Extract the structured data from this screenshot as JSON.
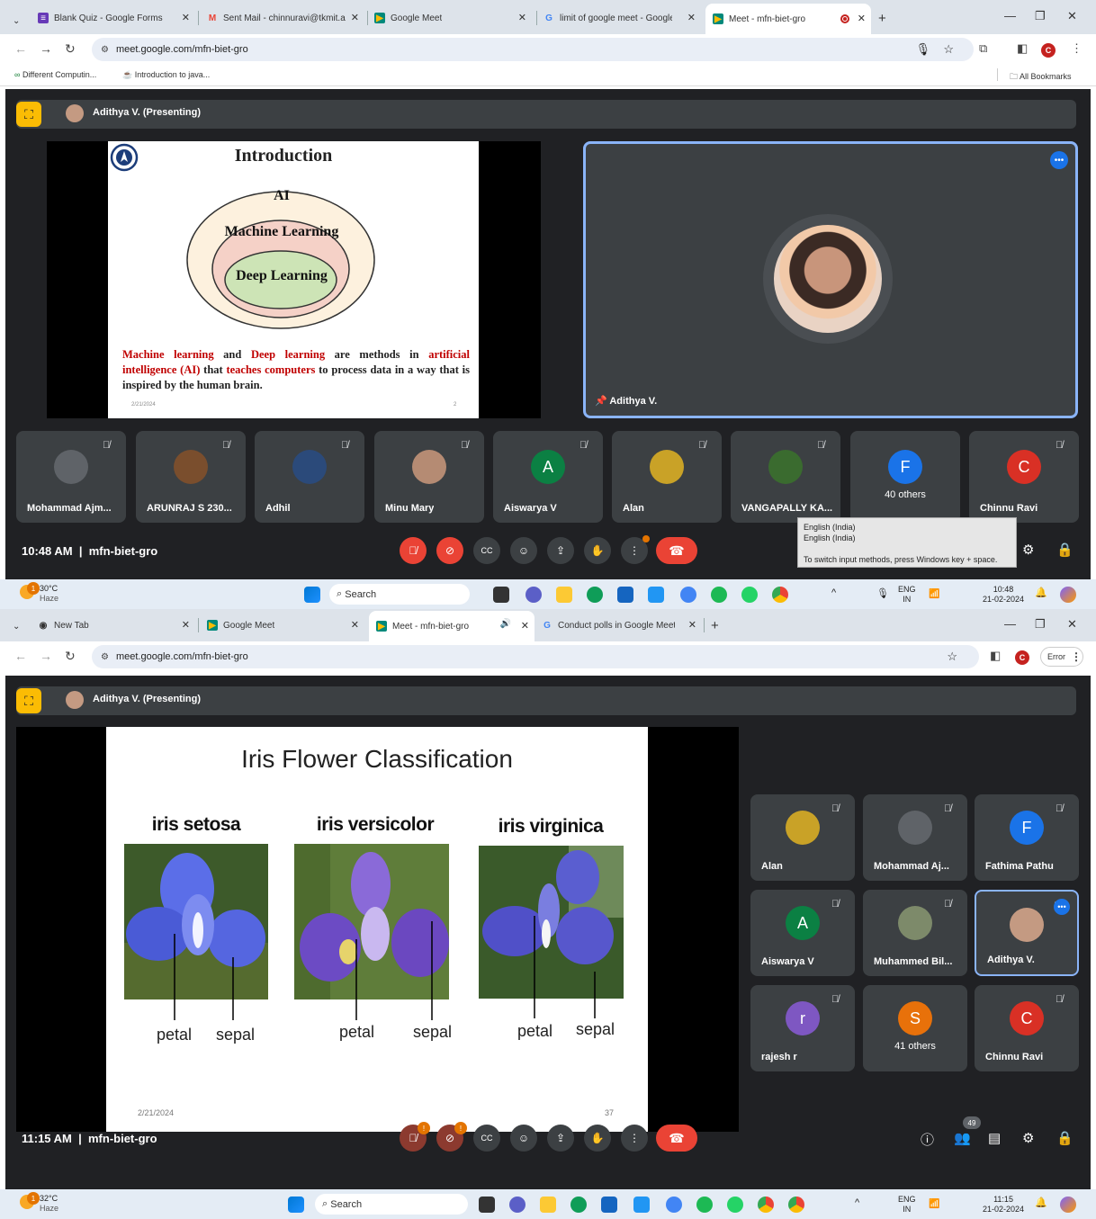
{
  "screen1": {
    "tabs": [
      {
        "label": "Blank Quiz - Google Forms",
        "icon": "forms-icon"
      },
      {
        "label": "Sent Mail - chinnuravi@tkmit.a",
        "icon": "gmail-icon"
      },
      {
        "label": "Google Meet",
        "icon": "meet-icon"
      },
      {
        "label": "limit of google meet - Google S",
        "icon": "google-icon"
      },
      {
        "label": "Meet - mfn-biet-gro",
        "icon": "meet-icon"
      }
    ],
    "url": "meet.google.com/mfn-biet-gro",
    "bookmarks": [
      "Different Computin...",
      "Introduction to java..."
    ],
    "all_bookmarks": "All Bookmarks",
    "presenter_label": "Adithya V. (Presenting)",
    "slide": {
      "title": "Introduction",
      "ring_outer": "AI",
      "ring_middle": "Machine Learning",
      "ring_inner": "Deep Learning",
      "text_parts": [
        "Machine learning",
        " and ",
        "Deep learning",
        " are methods in ",
        "artificial intelligence (AI)",
        " that ",
        "teaches computers",
        " to process data in a way that is inspired by the human brain."
      ],
      "date": "2/21/2024",
      "page": "2"
    },
    "spotlight_name": "Adithya V.",
    "participants": [
      {
        "name": "Mohammad Ajm...",
        "initial": "",
        "color": "#5f6368"
      },
      {
        "name": "ARUNRAJ S 230...",
        "initial": "",
        "color": "#7a4e2d"
      },
      {
        "name": "Adhil",
        "initial": "",
        "color": "#2b4a7a"
      },
      {
        "name": "Minu Mary",
        "initial": "",
        "color": "#b58b73"
      },
      {
        "name": "Aiswarya V",
        "initial": "A",
        "color": "#0b8043"
      },
      {
        "name": "Alan",
        "initial": "",
        "color": "#c9a227"
      },
      {
        "name": "VANGAPALLY KA...",
        "initial": "",
        "color": "#3a6b2f"
      },
      {
        "name": "Chinnu Ravi",
        "initial": "C",
        "color": "#d93025"
      }
    ],
    "others": {
      "label": "40 others",
      "initial": "F"
    },
    "time": "10:48 AM",
    "meeting_code": "mfn-biet-gro",
    "ime_tooltip": {
      "line1": "English (India)",
      "line2": "English (India)",
      "line3": "To switch input methods, press Windows key + space."
    },
    "taskbar": {
      "temp": "30°C",
      "weather": "Haze",
      "search": "Search",
      "lang1": "ENG",
      "lang2": "IN",
      "clock_time": "10:48",
      "clock_date": "21-02-2024",
      "badge": "1"
    }
  },
  "screen2": {
    "tabs": [
      {
        "label": "New Tab",
        "icon": "chrome-icon"
      },
      {
        "label": "Google Meet",
        "icon": "meet-icon"
      },
      {
        "label": "Meet - mfn-biet-gro",
        "icon": "meet-icon"
      },
      {
        "label": "Conduct polls in Google Meet",
        "icon": "google-icon"
      }
    ],
    "url": "meet.google.com/mfn-biet-gro",
    "error_label": "Error",
    "presenter_label": "Adithya V. (Presenting)",
    "slide": {
      "title": "Iris Flower Classification",
      "flowers": [
        {
          "name": "iris setosa",
          "label1": "petal",
          "label2": "sepal"
        },
        {
          "name": "iris versicolor",
          "label1": "petal",
          "label2": "sepal"
        },
        {
          "name": "iris virginica",
          "label1": "petal",
          "label2": "sepal"
        }
      ],
      "date": "2/21/2024",
      "page": "37"
    },
    "participants": [
      {
        "name": "Alan",
        "initial": "",
        "color": "#c9a227"
      },
      {
        "name": "Mohammad Aj...",
        "initial": "",
        "color": "#5f6368"
      },
      {
        "name": "Fathima Pathu",
        "initial": "F",
        "color": "#1a73e8"
      },
      {
        "name": "Aiswarya V",
        "initial": "A",
        "color": "#0b8043"
      },
      {
        "name": "Muhammed Bil...",
        "initial": "",
        "color": "#7d8a6a"
      },
      {
        "name": "Adithya V.",
        "initial": "",
        "color": "#c49a82"
      },
      {
        "name": "rajesh r",
        "initial": "r",
        "color": "#7e57c2"
      },
      {
        "name": "41 others",
        "initial": "S",
        "color": "#e8710a"
      },
      {
        "name": "Chinnu Ravi",
        "initial": "C",
        "color": "#d93025"
      }
    ],
    "time": "11:15 AM",
    "meeting_code": "mfn-biet-gro",
    "people_count": "49",
    "taskbar": {
      "temp": "32°C",
      "weather": "Haze",
      "search": "Search",
      "lang1": "ENG",
      "lang2": "IN",
      "clock_time": "11:15",
      "clock_date": "21-02-2024",
      "badge": "1"
    }
  }
}
